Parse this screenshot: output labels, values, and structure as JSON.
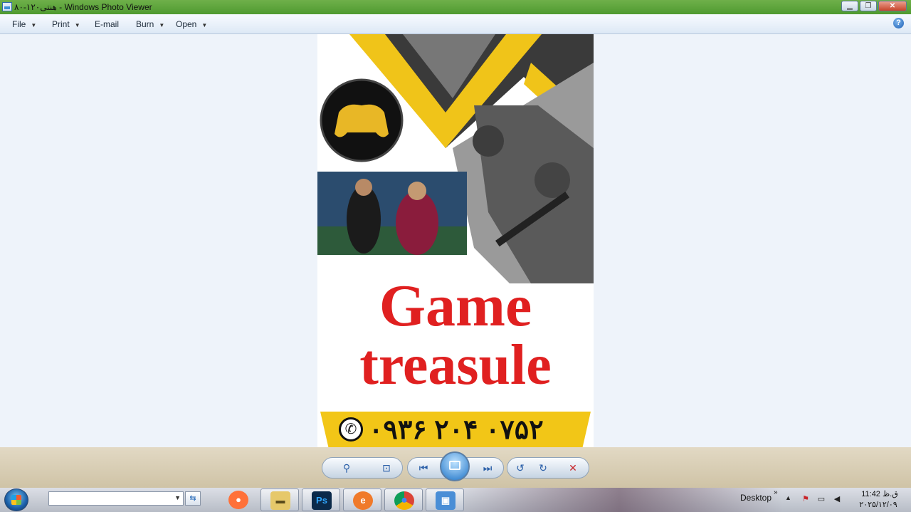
{
  "window": {
    "title": "هنتی۱۲۰-۸۰ - Windows Photo Viewer",
    "buttons": {
      "minimize": "▁",
      "maximize": "❐",
      "close": "✕"
    }
  },
  "menu": {
    "items": [
      {
        "label": "File",
        "has_dropdown": true
      },
      {
        "label": "Print",
        "has_dropdown": true
      },
      {
        "label": "E-mail",
        "has_dropdown": false
      },
      {
        "label": "Burn",
        "has_dropdown": true
      },
      {
        "label": "Open",
        "has_dropdown": true
      }
    ],
    "help": "?"
  },
  "poster": {
    "title_line1": "Game",
    "title_line2": "treasule",
    "phone": "۰۹۳۶ ۲۰۴ ۰۷۵۲",
    "accent_color": "#f2c617",
    "title_color": "#e02020"
  },
  "controls": {
    "zoom": "⚲",
    "actual_size": "⊡",
    "previous": "⏮",
    "next": "⏭",
    "rotate_ccw": "↺",
    "rotate_cw": "↻",
    "delete": "✕"
  },
  "taskbar": {
    "apps": [
      {
        "name": "firefox",
        "glyph": "🦊",
        "color": "#ff7139"
      },
      {
        "name": "file-explorer",
        "glyph": "🗂",
        "color": "#e6c86a"
      },
      {
        "name": "photoshop",
        "glyph": "Ps",
        "color": "#0b2a4a"
      },
      {
        "name": "app-orange",
        "glyph": "e",
        "color": "#f07a2a"
      },
      {
        "name": "chrome",
        "glyph": "◉",
        "color": "#db4437"
      },
      {
        "name": "photo-viewer",
        "glyph": "▣",
        "color": "#4a8ed6"
      }
    ],
    "tray_label": "Desktop",
    "chevron": "»",
    "clock_time": "ق.ظ 11:42",
    "clock_date": "۲۰۲۵/۱۲/۰۹"
  }
}
